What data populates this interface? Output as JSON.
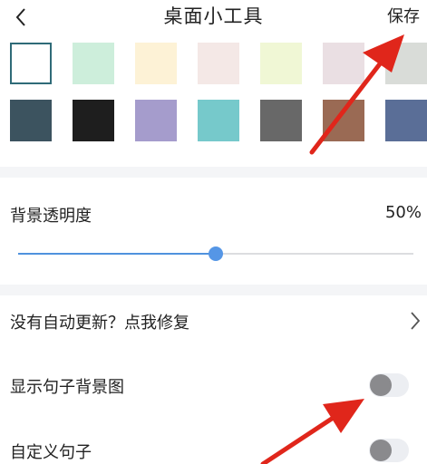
{
  "header": {
    "title": "桌面小工具",
    "save_label": "保存"
  },
  "swatches": {
    "row1": [
      "#ffffff",
      "#cdeedb",
      "#fdf2d6",
      "#f4e8e6",
      "#f0f7d5",
      "#eadfe3",
      "#d9dcd8"
    ],
    "row2": [
      "#3c535f",
      "#1e1e1e",
      "#a59ccc",
      "#76c9cb",
      "#686868",
      "#9a6a54",
      "#5a6e97"
    ],
    "selected_index": 0
  },
  "opacity": {
    "label": "背景透明度",
    "value_text": "50%",
    "value": 0.5
  },
  "settings": {
    "repair_label": "没有自动更新？点我修复",
    "show_bg_label": "显示句子背景图",
    "show_bg_on": false,
    "custom_label": "自定义句子",
    "custom_on": false
  },
  "colors": {
    "accent": "#5596e6",
    "toggle_off_knob": "#8a8a8d",
    "annotation_arrow": "#e0261b"
  }
}
